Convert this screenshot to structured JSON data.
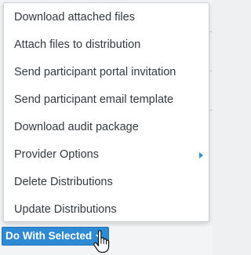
{
  "menu": {
    "items": [
      {
        "label": "Download attached files"
      },
      {
        "label": "Attach files to distribution"
      },
      {
        "label": "Send participant portal invitation"
      },
      {
        "label": "Send participant email template"
      },
      {
        "label": "Download audit package"
      },
      {
        "label": "Provider Options",
        "has_submenu": true
      },
      {
        "label": "Delete Distributions"
      },
      {
        "label": "Update Distributions"
      }
    ]
  },
  "action_button": {
    "label": "Do With Selected"
  },
  "colors": {
    "accent": "#2e8ad3",
    "menu_text": "#333a40",
    "submenu_arrow": "#2f8fd8"
  },
  "icons": {
    "submenu": "caret-right-icon",
    "dropdown": "caret-down-icon",
    "cursor": "hand-pointer-cursor-icon"
  }
}
